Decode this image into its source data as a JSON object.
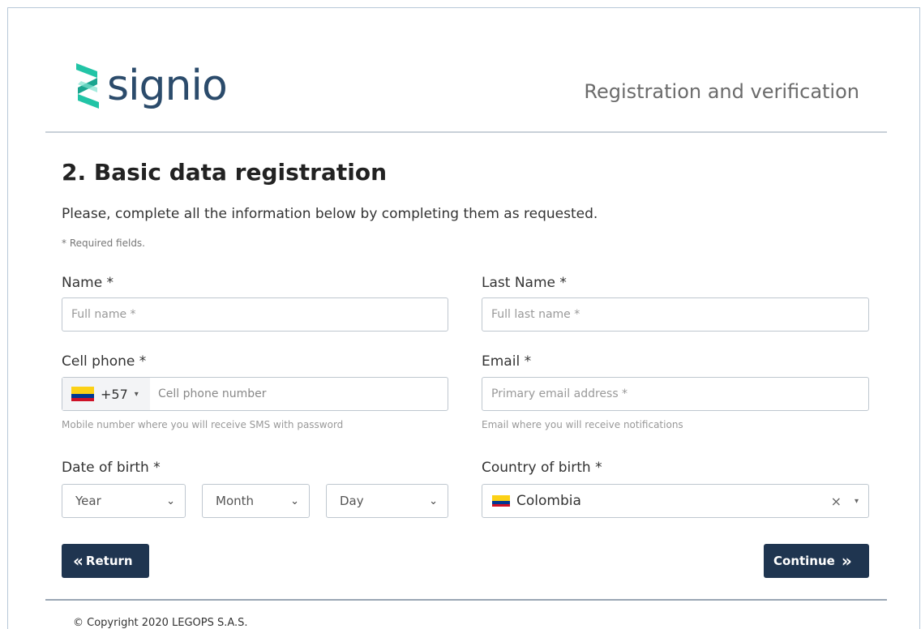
{
  "header": {
    "logo_text": "signio",
    "right_title": "Registration and verification"
  },
  "form": {
    "title": "2. Basic data registration",
    "intro": "Please, complete all the information below by completing them as requested.",
    "required_note": "* Required fields.",
    "name": {
      "label": "Name *",
      "placeholder": "Full name *",
      "value": ""
    },
    "last_name": {
      "label": "Last Name *",
      "placeholder": "Full last name *",
      "value": ""
    },
    "cell_phone": {
      "label": "Cell phone *",
      "country_code": "+57",
      "flag": "colombia-flag",
      "placeholder": "Cell phone number",
      "hint": "Mobile number where you will receive SMS with password"
    },
    "email": {
      "label": "Email *",
      "placeholder": "Primary email address *",
      "hint": "Email where you will receive notifications"
    },
    "dob": {
      "label": "Date of birth *",
      "year": "Year",
      "month": "Month",
      "day": "Day"
    },
    "country": {
      "label": "Country of birth *",
      "value": "Colombia",
      "flag": "colombia-flag",
      "clear": "×"
    }
  },
  "actions": {
    "return_label": "Return",
    "continue_label": "Continue"
  },
  "footer": {
    "copyright": "© Copyright 2020 LEGOPS S.A.S."
  },
  "colors": {
    "button": "#1f3550",
    "logo_teal": "#22c4a6",
    "logo_text": "#2b4b6b"
  }
}
